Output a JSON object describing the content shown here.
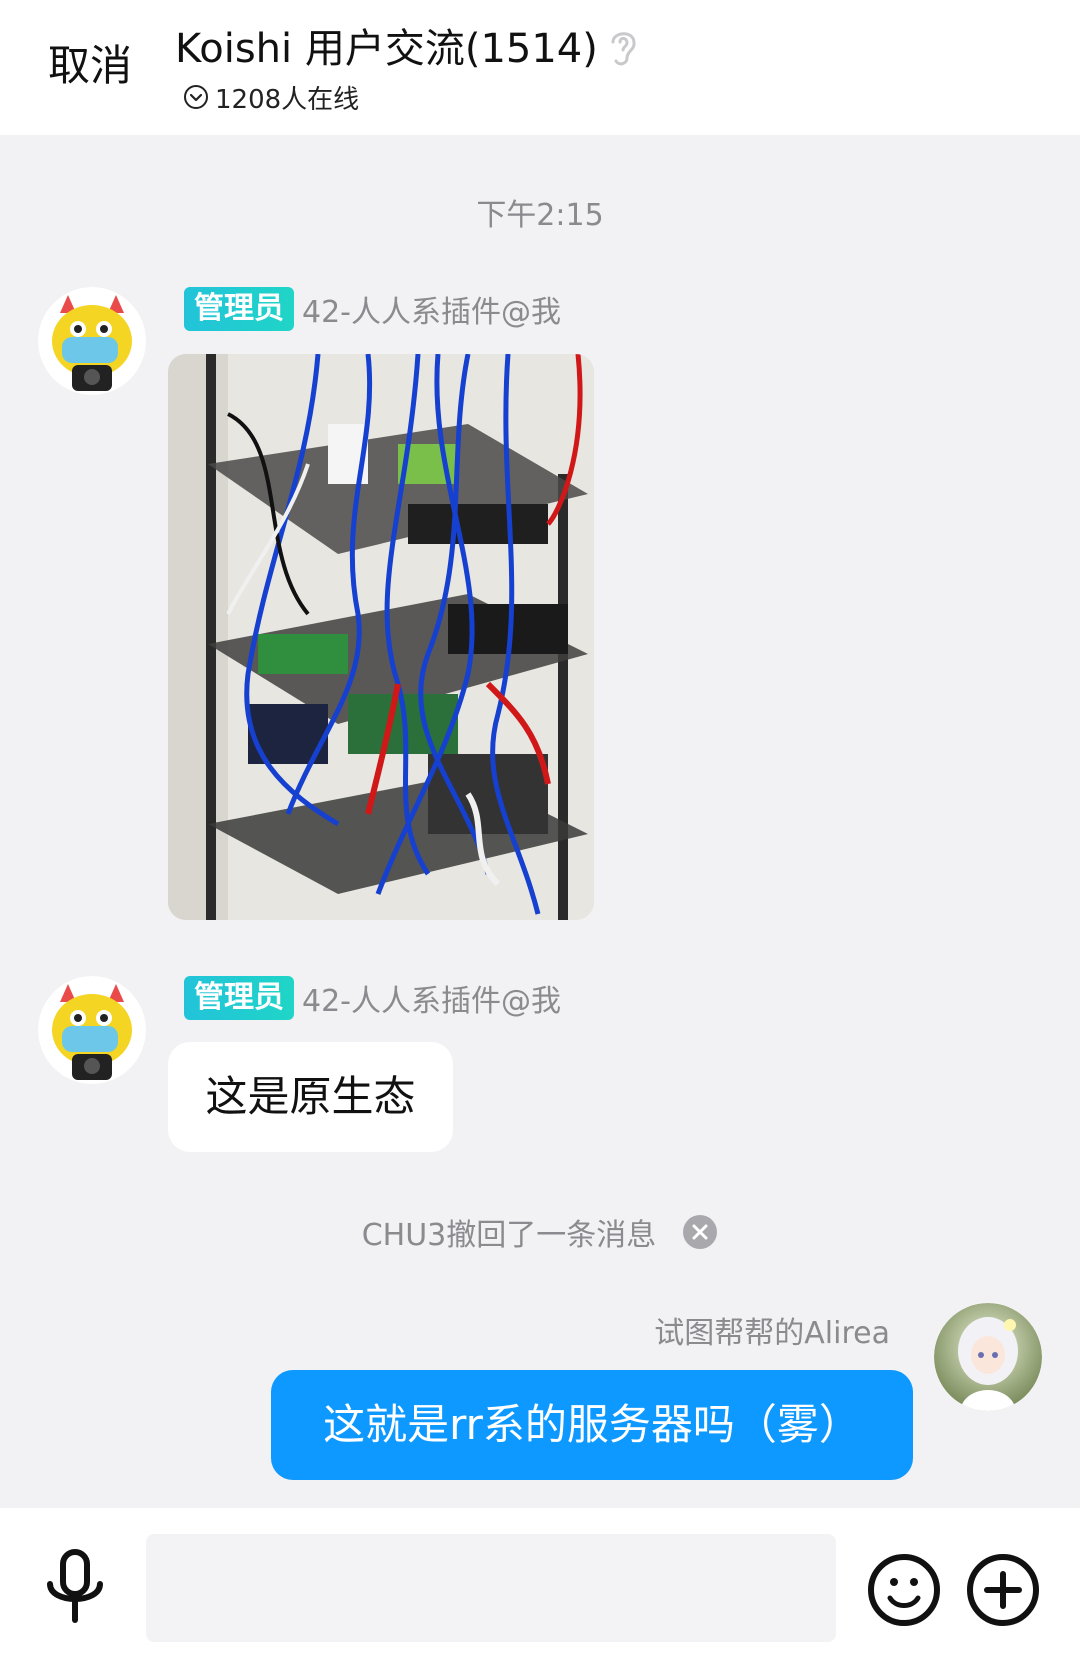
{
  "header": {
    "cancel_label": "取消",
    "group_title": "Koishi 用户交流(1514)",
    "online_text": "1208人在线"
  },
  "messages": {
    "timestamp": "下午2:15",
    "msg1": {
      "badge": "管理员",
      "sender": "42-人人系插件@我"
    },
    "msg2": {
      "badge": "管理员",
      "sender": "42-人人系插件@我",
      "text": "这是原生态"
    },
    "recall_text": "CHU3撤回了一条消息",
    "msg3": {
      "sender": "试图帮帮的Alirea",
      "text": "这就是rr系的服务器吗（雾）"
    }
  },
  "composer": {
    "input_value": "",
    "input_placeholder": ""
  },
  "colors": {
    "accent_blue": "#0d99ff",
    "badge_teal": "#22c3d9",
    "background": "#f2f2f4"
  },
  "icons": [
    "ear-icon",
    "online-check-icon",
    "close-circle-icon",
    "microphone-icon",
    "emoji-icon",
    "plus-circle-icon"
  ]
}
